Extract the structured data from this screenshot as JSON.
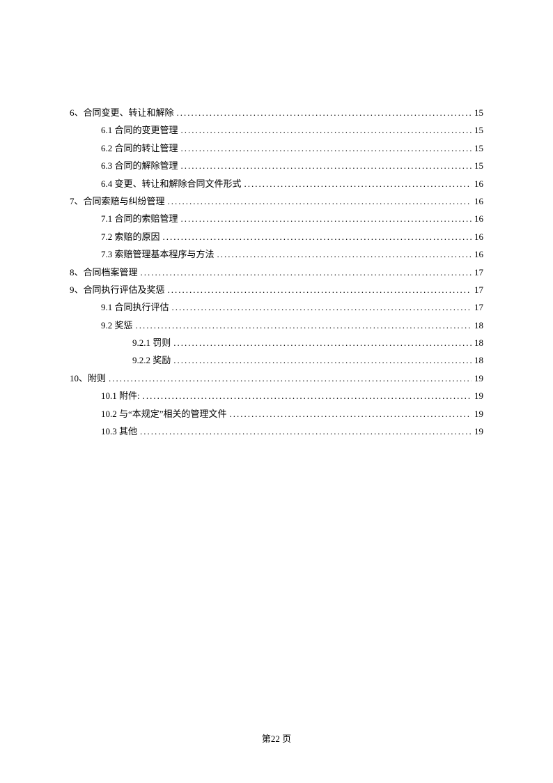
{
  "toc": [
    {
      "level": 1,
      "label": "6、合同变更、转让和解除",
      "page": "15"
    },
    {
      "level": 2,
      "label": "6.1 合同的变更管理",
      "page": "15"
    },
    {
      "level": 2,
      "label": "6.2 合同的转让管理",
      "page": "15"
    },
    {
      "level": 2,
      "label": "6.3 合同的解除管理",
      "page": "15"
    },
    {
      "level": 2,
      "label": "6.4 变更、转让和解除合同文件形式",
      "page": "16"
    },
    {
      "level": 1,
      "label": "7、合同索赔与纠纷管理",
      "page": "16"
    },
    {
      "level": 2,
      "label": "7.1 合同的索赔管理",
      "page": "16"
    },
    {
      "level": 2,
      "label": "7.2 索赔的原因",
      "page": "16"
    },
    {
      "level": 2,
      "label": "7.3 索赔管理基本程序与方法",
      "page": "16"
    },
    {
      "level": 1,
      "label": "8、合同档案管理",
      "page": "17"
    },
    {
      "level": 1,
      "label": "9、合同执行评估及奖惩",
      "page": "17"
    },
    {
      "level": 2,
      "label": "9.1 合同执行评估",
      "page": "17"
    },
    {
      "level": 2,
      "label": "9.2 奖惩",
      "page": "18"
    },
    {
      "level": 3,
      "label": "9.2.1 罚则",
      "page": "18"
    },
    {
      "level": 3,
      "label": "9.2.2 奖励",
      "page": "18"
    },
    {
      "level": 1,
      "label": "10、附则",
      "page": "19"
    },
    {
      "level": 2,
      "label": "10.1 附件:",
      "page": "19"
    },
    {
      "level": 2,
      "label": "10.2 与“本规定”相关的管理文件",
      "page": "19"
    },
    {
      "level": 2,
      "label": "10.3 其他",
      "page": "19"
    }
  ],
  "footer": {
    "page_label": "第22 页"
  }
}
